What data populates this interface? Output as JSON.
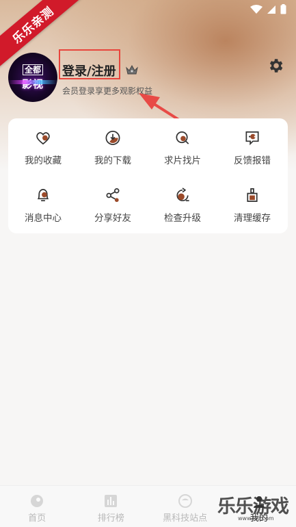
{
  "ribbon": {
    "text": "乐乐亲测"
  },
  "avatar": {
    "line1": "全都",
    "line2": "影视"
  },
  "profile": {
    "title": "登录/注册",
    "subtitle": "会员登录享更多观影权益"
  },
  "menu": {
    "items": [
      {
        "label": "我的收藏",
        "icon": "heart-icon"
      },
      {
        "label": "我的下载",
        "icon": "download-icon"
      },
      {
        "label": "求片找片",
        "icon": "search-film-icon"
      },
      {
        "label": "反馈报错",
        "icon": "feedback-icon"
      },
      {
        "label": "消息中心",
        "icon": "bell-icon"
      },
      {
        "label": "分享好友",
        "icon": "share-icon"
      },
      {
        "label": "检查升级",
        "icon": "upgrade-icon"
      },
      {
        "label": "清理缓存",
        "icon": "clean-icon"
      }
    ]
  },
  "nav": {
    "items": [
      {
        "label": "首页",
        "icon": "home-icon"
      },
      {
        "label": "排行榜",
        "icon": "rank-icon"
      },
      {
        "label": "黑科技站点",
        "icon": "site-icon"
      },
      {
        "label": "我的",
        "icon": "profile-icon"
      }
    ]
  },
  "watermark": {
    "text": "乐乐游戏",
    "url": "www.lelf.com"
  },
  "colors": {
    "accent": "#9b4a2a",
    "highlight": "#e8453c",
    "ribbon": "#d11a2a"
  }
}
